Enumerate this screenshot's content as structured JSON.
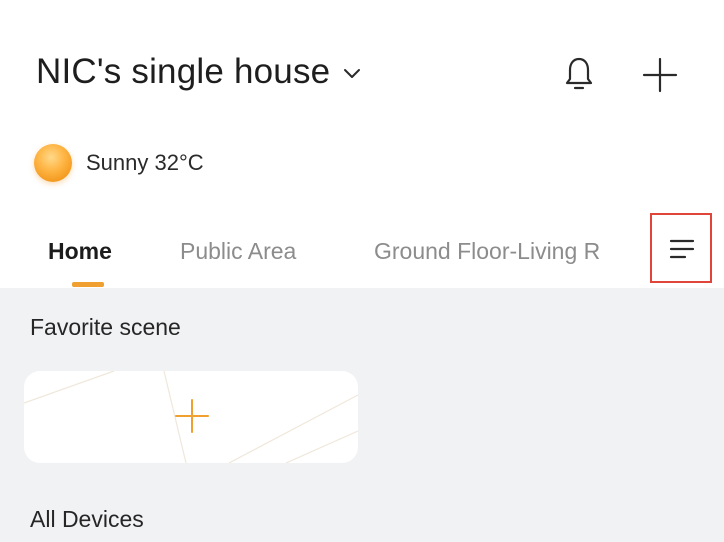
{
  "header": {
    "house_title": "NIC's single house",
    "icons": [
      "chevron-down-icon",
      "bell-icon",
      "plus-icon"
    ]
  },
  "weather": {
    "text": "Sunny 32°C",
    "icon": "sun-icon"
  },
  "tabs": [
    {
      "label": "Home",
      "active": true
    },
    {
      "label": "Public Area",
      "active": false
    },
    {
      "label": "Ground Floor-Living R",
      "active": false
    }
  ],
  "tab_menu": {
    "icon": "list-menu-icon"
  },
  "favorite_scene": {
    "title": "Favorite scene",
    "add_icon": "plus-icon"
  },
  "all_devices": {
    "title": "All Devices"
  },
  "colors": {
    "accent": "#f0a030",
    "highlight_border": "#e0453a",
    "section_background": "#f1f2f4",
    "inactive_tab": "#8c8c8c"
  }
}
